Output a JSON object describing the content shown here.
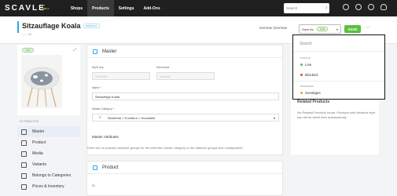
{
  "topbar": {
    "logo": "SCAVLE",
    "logo_badge": "BY PIMCY",
    "nav": [
      "Shops",
      "Products",
      "Settings",
      "Add-Ons"
    ],
    "active_nav": "Products",
    "search_placeholder": "Search",
    "search_shortcut": "/",
    "icons": [
      "chat-icon",
      "help-icon",
      "bell-icon",
      "user-icon"
    ]
  },
  "header": {
    "title": "Sitzauflage Koala",
    "badge": "PRODUCT",
    "breadcrumb": "— › 46",
    "language": "German (German",
    "save_as_label": "Save As",
    "save_as_state": "LIVE",
    "save_button": "SAVE",
    "more": "···"
  },
  "left": {
    "status": "LIVE",
    "attributes_heading": "ATTRIBUTES",
    "nav": [
      {
        "label": "Master",
        "icon": "master-icon",
        "active": true
      },
      {
        "label": "Product",
        "icon": "product-icon",
        "active": false
      },
      {
        "label": "Media",
        "icon": "media-icon",
        "active": false
      },
      {
        "label": "Variants",
        "icon": "variants-icon",
        "active": false
      },
      {
        "label": "Belongs to Categories",
        "icon": "categories-icon",
        "active": false
      },
      {
        "label": "Prices & Inventory",
        "icon": "prices-icon",
        "active": false
      }
    ]
  },
  "master": {
    "heading": "Master",
    "style_key_label": "Style Key",
    "style_key_value": "2032209",
    "merchants_label": "Merchants",
    "merchants_value": "Default",
    "name_label": "Name *",
    "name_value": "Sitzauflage Koala",
    "category_label": "Master Category *",
    "category_value": "Storefront > Furniture > Hochstuhl",
    "attributes_heading": "Master Attributes",
    "attributes_hint": "There are no (master) attribute groups for the selected master category or the attribute groups lack configuration."
  },
  "product": {
    "heading": "Product",
    "id_label": "ID"
  },
  "dropdown": {
    "search_placeholder": "Search",
    "status_heading": "STATUS",
    "status_items": [
      {
        "label": "Live",
        "color": "#5cbf3f"
      },
      {
        "label": "Blocked",
        "color": "#d64545"
      }
    ],
    "problem_heading": "PROBLEM",
    "problem_items": [
      {
        "label": "Sonstiges",
        "color": "#f0a020"
      }
    ]
  },
  "related": {
    "title": "Related Products",
    "text": "No Related Products found. Products with identical style key will be listed here automatically."
  }
}
